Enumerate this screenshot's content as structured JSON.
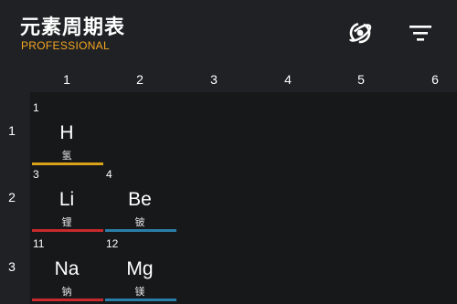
{
  "app": {
    "title": "元素周期表",
    "subtitle": "PROFESSIONAL"
  },
  "toolbar": {
    "orbit_icon": "atom-orbit-icon",
    "filter_icon": "filter-icon"
  },
  "columns": [
    "1",
    "2",
    "3",
    "4",
    "5",
    "6"
  ],
  "rows": [
    "1",
    "2",
    "3"
  ],
  "colors": {
    "background": "#1f2124",
    "table_bg": "#17181a",
    "subtitle": "#f5a623",
    "nonmetal": "#d9a21a",
    "alkali": "#c7292c",
    "alkaline_earth": "#2a7fa8"
  },
  "elements": [
    {
      "number": "1",
      "symbol": "H",
      "name": "氢",
      "category": "nonmetal"
    },
    {
      "number": "3",
      "symbol": "Li",
      "name": "锂",
      "category": "alkali"
    },
    {
      "number": "4",
      "symbol": "Be",
      "name": "铍",
      "category": "alkaline_earth"
    },
    {
      "number": "11",
      "symbol": "Na",
      "name": "钠",
      "category": "alkali"
    },
    {
      "number": "12",
      "symbol": "Mg",
      "name": "镁",
      "category": "alkaline_earth"
    }
  ]
}
